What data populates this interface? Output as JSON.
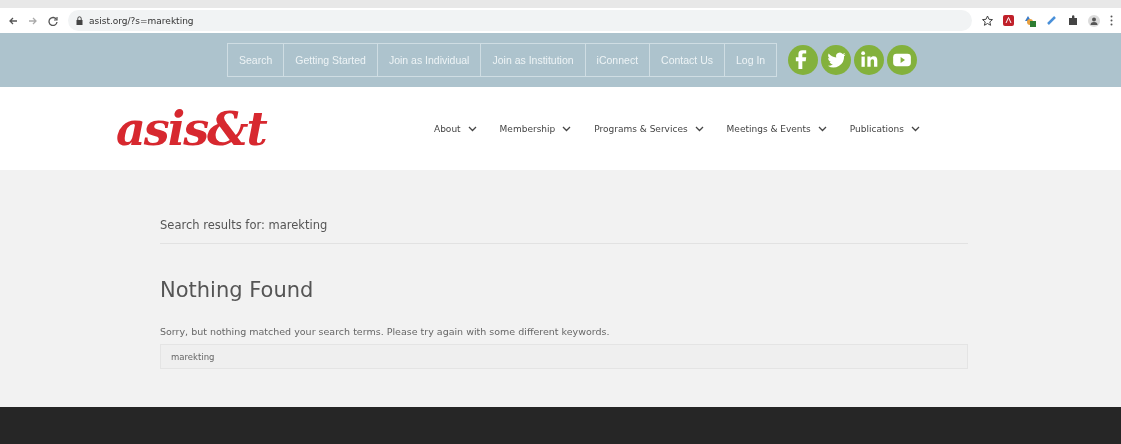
{
  "browser": {
    "url": "asist.org/?s=marekting"
  },
  "top_links": [
    "Search",
    "Getting Started",
    "Join as Individual",
    "Join as Institution",
    "iConnect",
    "Contact Us",
    "Log In"
  ],
  "social": [
    {
      "kind": "facebook"
    },
    {
      "kind": "twitter"
    },
    {
      "kind": "linkedin"
    },
    {
      "kind": "youtube"
    }
  ],
  "logo": "asis&t",
  "main_nav": [
    "About",
    "Membership",
    "Programs & Services",
    "Meetings & Events",
    "Publications"
  ],
  "results": {
    "heading": "Search results for: marekting",
    "title": "Nothing Found",
    "message": "Sorry, but nothing matched your search terms. Please try again with some different keywords.",
    "search_value": "marekting"
  }
}
